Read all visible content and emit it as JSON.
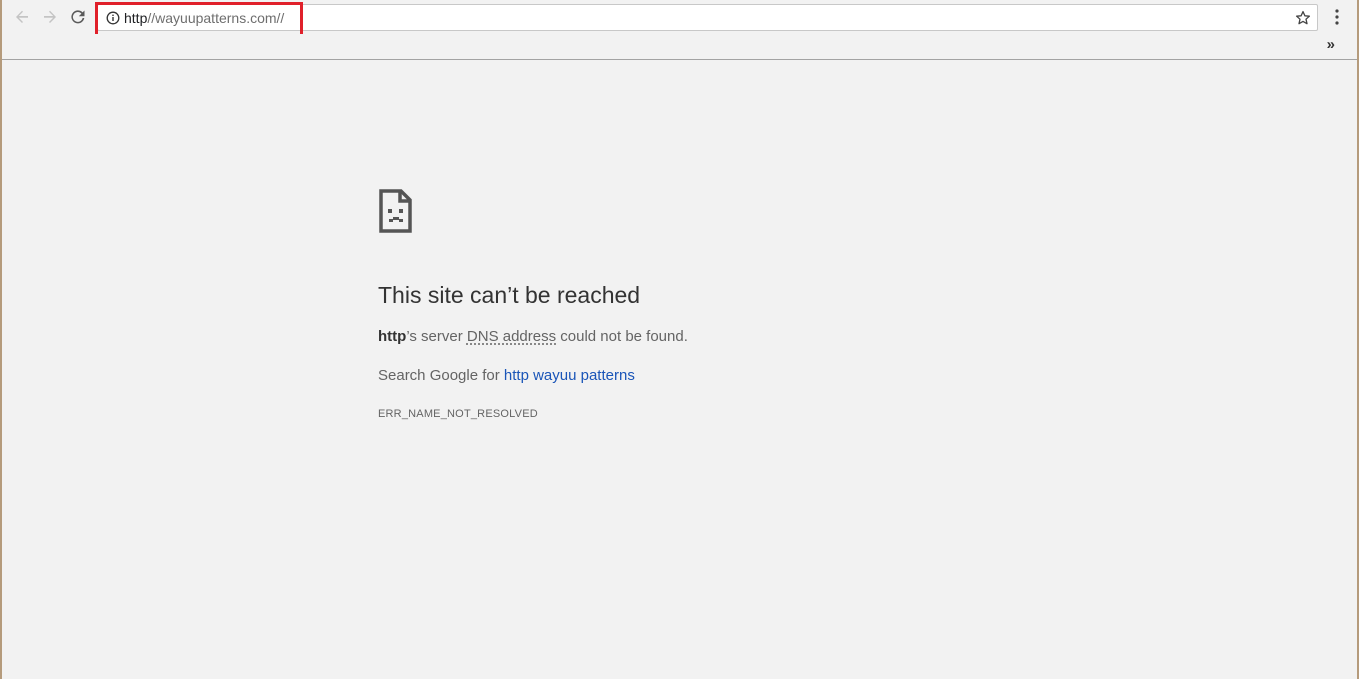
{
  "toolbar": {
    "url_host": "http",
    "url_rest": "//wayuupatterns.com//",
    "back_icon": "arrow-left-icon",
    "forward_icon": "arrow-right-icon",
    "reload_icon": "reload-icon",
    "info_icon": "info-icon",
    "star_icon": "star-icon",
    "menu_icon": "vertical-dots-icon"
  },
  "bookmarks_bar": {
    "overflow_label": "»"
  },
  "error_page": {
    "icon": "sad-page-icon",
    "title": "This site can’t be reached",
    "detail_host": "http",
    "detail_middle": "’s server ",
    "detail_abbr": "DNS address",
    "detail_end": " could not be found.",
    "suggest_prefix": "Search Google for ",
    "suggest_link": "http wayuu patterns",
    "error_code": "ERR_NAME_NOT_RESOLVED"
  },
  "colors": {
    "highlight_box": "#e0202a",
    "link": "#1a55b8",
    "background": "#f2f2f2"
  }
}
